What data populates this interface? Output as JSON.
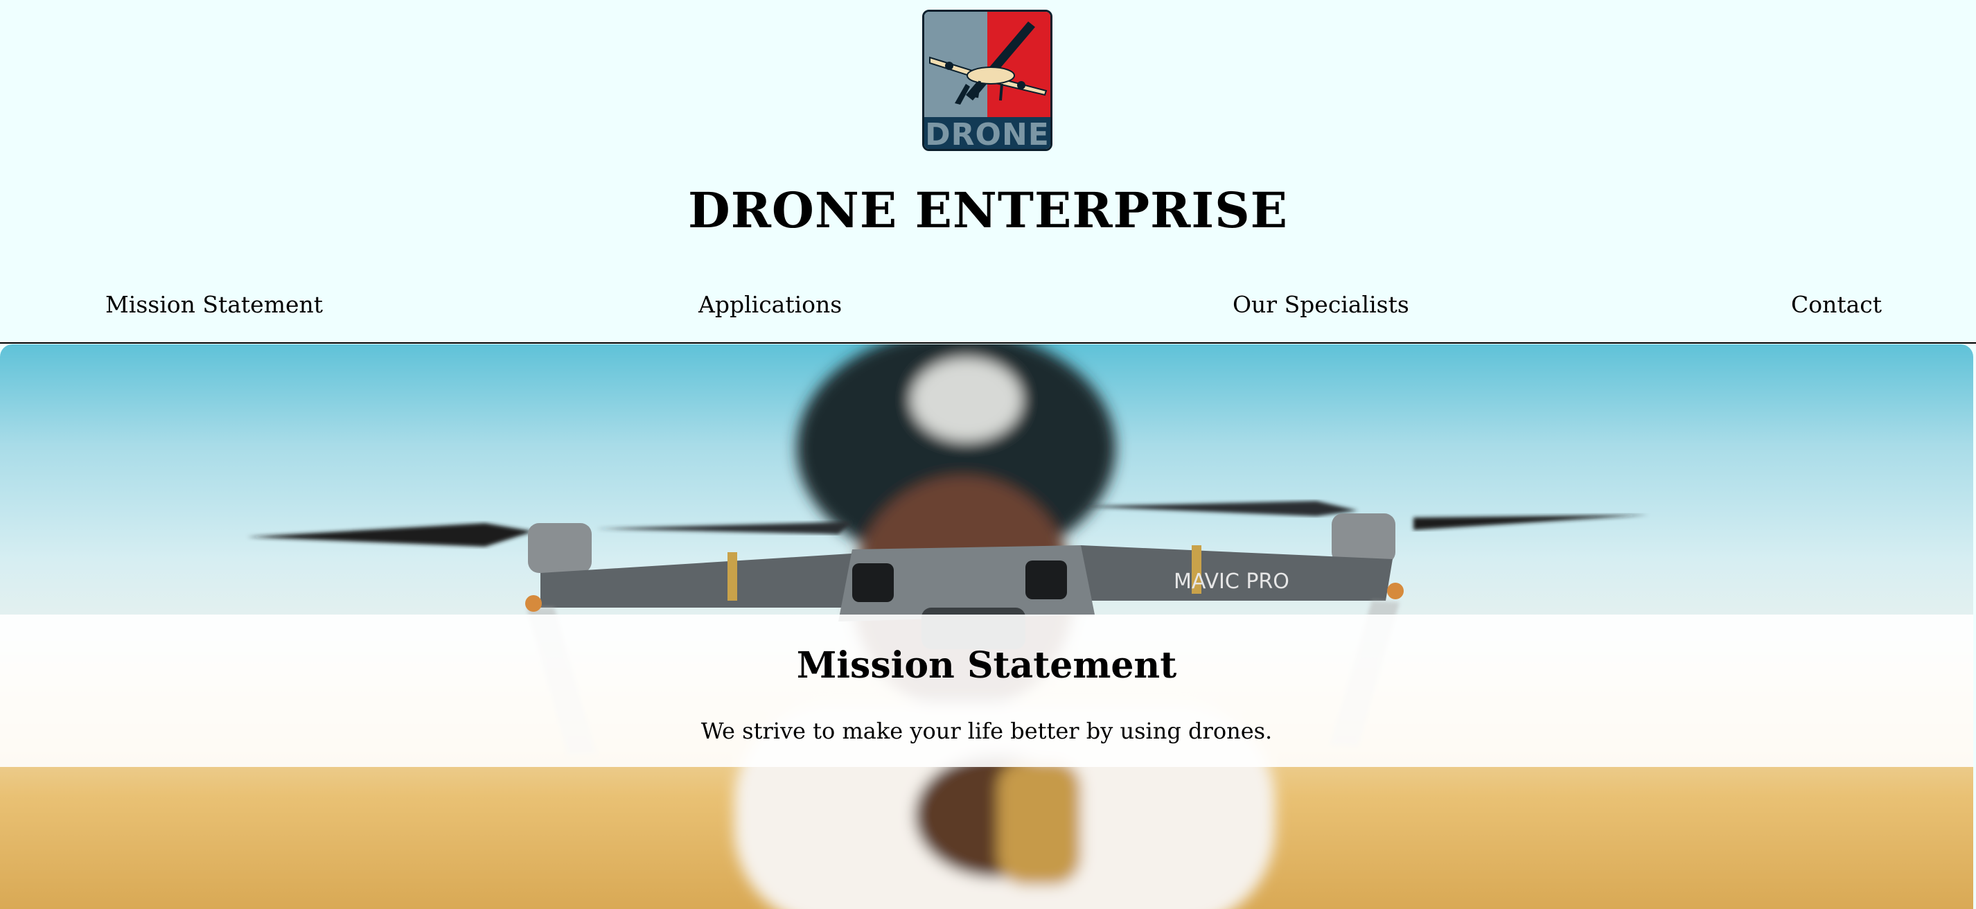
{
  "header": {
    "logo_text": "DRONE",
    "title": "DRONE ENTERPRISE"
  },
  "nav": {
    "items": [
      {
        "label": "Mission Statement"
      },
      {
        "label": "Applications"
      },
      {
        "label": "Our Specialists"
      },
      {
        "label": "Contact"
      }
    ]
  },
  "hero": {
    "drone_label": "MAVIC PRO",
    "mission_title": "Mission Statement",
    "mission_text": "We strive to make your life better by using drones."
  },
  "colors": {
    "header_bg": "#efffff",
    "logo_red": "#db1d25",
    "logo_blue": "#123a55",
    "logo_grey": "#7c97a5",
    "sky": "#5fc2d8",
    "field": "#e9c174"
  }
}
